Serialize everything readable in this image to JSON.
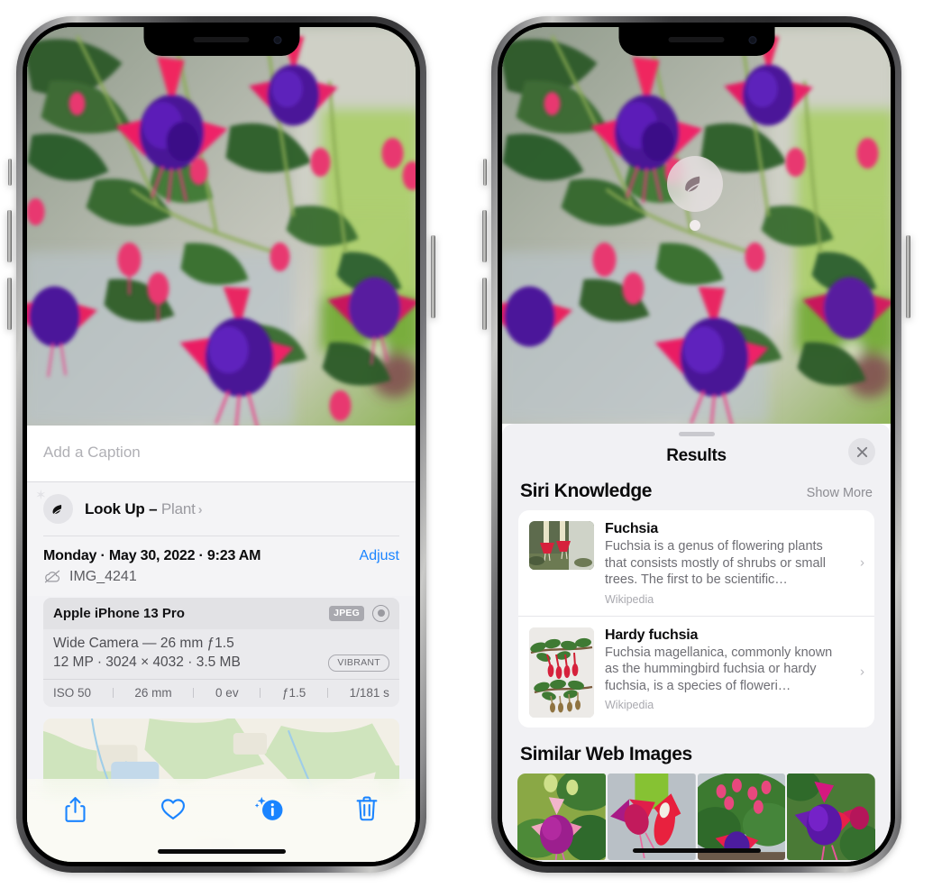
{
  "left_phone": {
    "caption_placeholder": "Add a Caption",
    "lookup": {
      "label": "Look Up – ",
      "subject": "Plant",
      "chevron": "›",
      "icon": "leaf-icon",
      "sparkle": "✦"
    },
    "info": {
      "date": "Monday · May 30, 2022 · 9:23 AM",
      "adjust": "Adjust",
      "filename": "IMG_4241",
      "cloud_icon": "cloud-slash-icon"
    },
    "camera": {
      "model": "Apple iPhone 13 Pro",
      "format_badge": "JPEG",
      "raw_icon": "raw-circle-icon",
      "lens_line": "Wide Camera — 26 mm ƒ1.5",
      "size_line": "12 MP · 3024 × 4032 · 3.5 MB",
      "style_badge": "VIBRANT",
      "exif": [
        "ISO 50",
        "26 mm",
        "0 ev",
        "ƒ1.5",
        "1/181 s"
      ]
    },
    "toolbar": [
      {
        "name": "share-button",
        "icon": "share-icon"
      },
      {
        "name": "favorite-button",
        "icon": "heart-icon"
      },
      {
        "name": "info-button",
        "icon": "info-sparkle-icon"
      },
      {
        "name": "delete-button",
        "icon": "trash-icon"
      }
    ]
  },
  "right_phone": {
    "visual_lookup_badge": {
      "icon": "leaf-icon"
    },
    "sheet": {
      "title": "Results",
      "close_icon": "close-icon"
    },
    "siri_knowledge": {
      "heading": "Siri Knowledge",
      "show_more": "Show More",
      "items": [
        {
          "title": "Fuchsia",
          "description": "Fuchsia is a genus of flowering plants that consists mostly of shrubs or small trees. The first to be scientific…",
          "source": "Wikipedia",
          "chevron": "›"
        },
        {
          "title": "Hardy fuchsia",
          "description": "Fuchsia magellanica, commonly known as the hummingbird fuchsia or hardy fuchsia, is a species of floweri…",
          "source": "Wikipedia",
          "chevron": "›"
        }
      ]
    },
    "similar_web_images": {
      "heading": "Similar Web Images",
      "count": 4
    }
  },
  "colors": {
    "accent_blue": "#1a84ff",
    "sheet_bg": "#f1f1f4",
    "card_bg": "#ffffff",
    "text_primary": "#0b0b0c",
    "text_secondary": "#6e6e74",
    "text_tertiary": "#a9a9af"
  }
}
